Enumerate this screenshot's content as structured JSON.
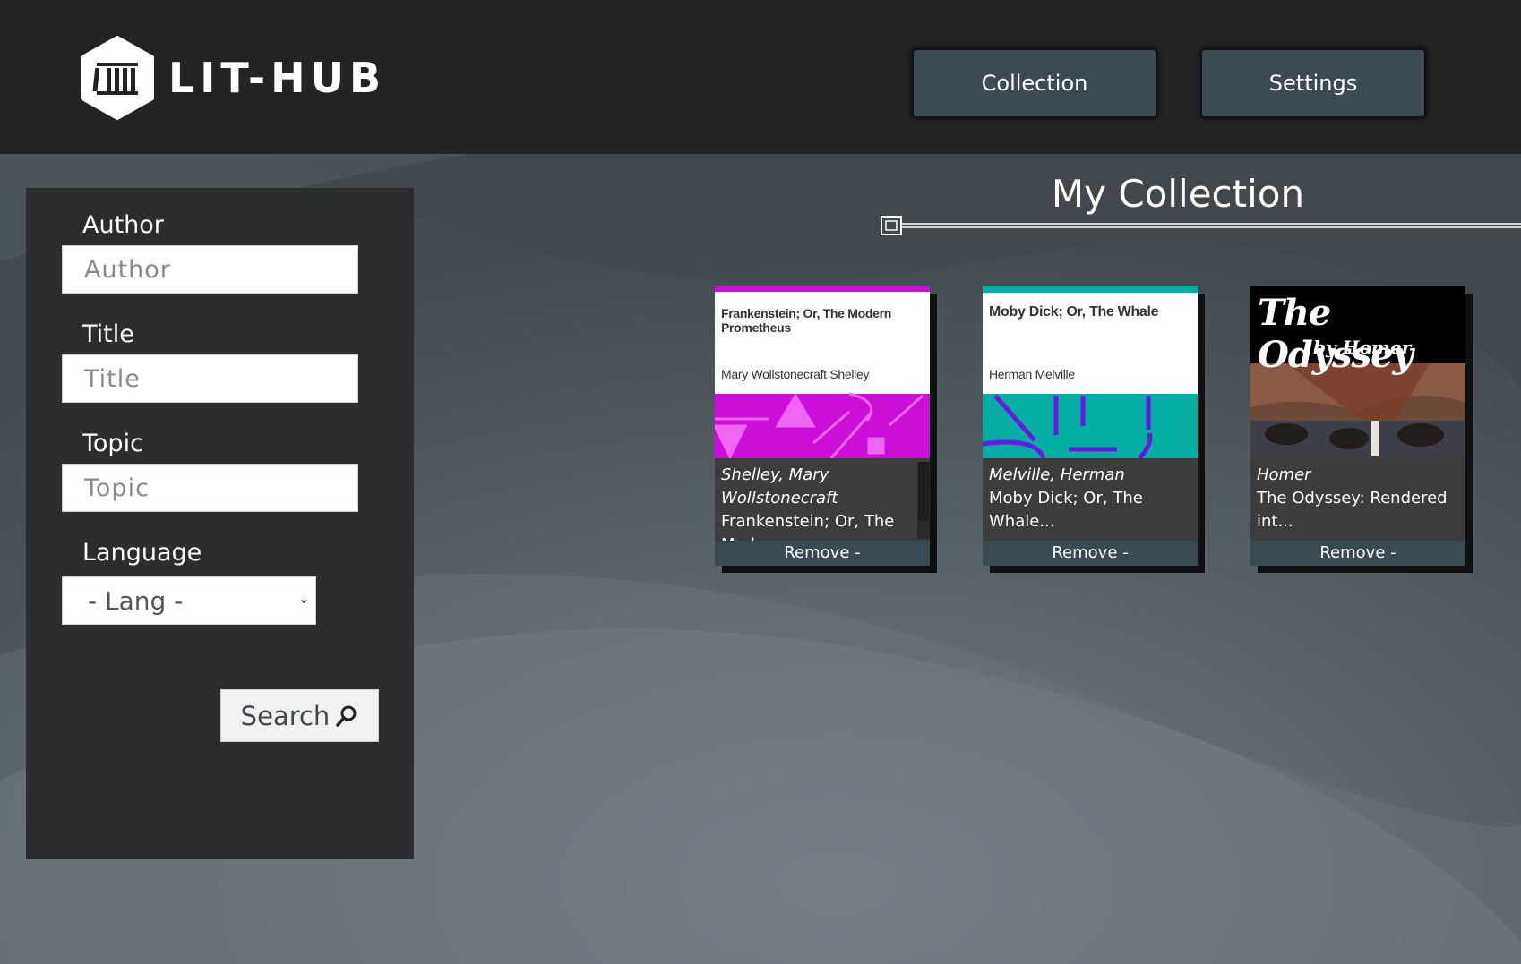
{
  "header": {
    "logo_text": "LIT-HUB",
    "nav": {
      "collection": "Collection",
      "settings": "Settings"
    }
  },
  "sidebar": {
    "author_label": "Author",
    "author_placeholder": "Author",
    "title_label": "Title",
    "title_placeholder": "Title",
    "topic_label": "Topic",
    "topic_placeholder": "Topic",
    "language_label": "Language",
    "language_selected": "- Lang -",
    "search_label": "Search"
  },
  "collection": {
    "heading": "My Collection",
    "remove_label": "Remove -",
    "books": [
      {
        "author": "Shelley, Mary Wollstonecraft",
        "title": "Frankenstein; Or, The Modern...",
        "cover_title": "Frankenstein; Or, The Modern Prometheus",
        "cover_author": "Mary Wollstonecraft Shelley",
        "cover_color": "#cc0ed9"
      },
      {
        "author": "Melville, Herman",
        "title": "Moby Dick; Or, The Whale...",
        "cover_title": "Moby Dick; Or, The Whale",
        "cover_author": "Herman Melville",
        "cover_color": "#04aea5"
      },
      {
        "author": "Homer",
        "title": "The Odyssey: Rendered int...",
        "cover_title": "The Odyssey",
        "cover_subtitle": "by Homer",
        "cover_color": "#000000"
      }
    ]
  }
}
